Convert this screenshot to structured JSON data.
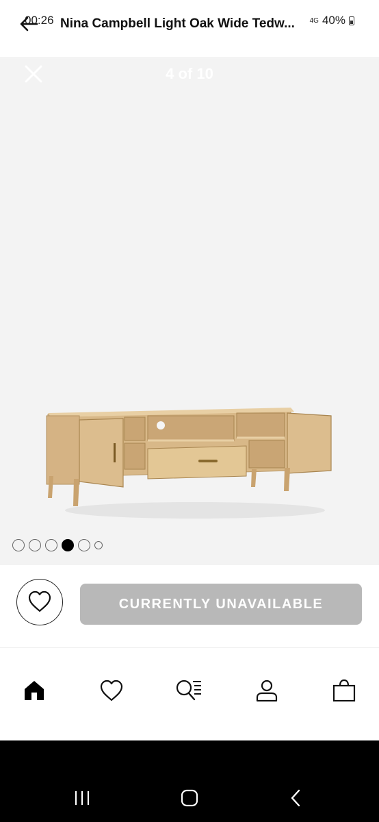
{
  "status_bar": {
    "time": "00:26",
    "network": "4G",
    "battery": "40%"
  },
  "header": {
    "title": "Nina Campbell Light Oak Wide Tedw..."
  },
  "gallery": {
    "counter": "4 of 10",
    "current_index": 4,
    "dot_count": 6,
    "image_icon": "tv-stand-image"
  },
  "actions": {
    "wishlist_icon": "heart-icon",
    "unavailable_label": "CURRENTLY UNAVAILABLE"
  },
  "bottom_nav": {
    "items": [
      "home-icon",
      "wishlist-icon",
      "search-icon",
      "account-icon",
      "basket-icon"
    ],
    "active": "home-icon"
  },
  "system_nav": {
    "items": [
      "recent-apps-icon",
      "home-button-icon",
      "back-icon"
    ]
  },
  "colors": {
    "gallery_bg": "#f3f3f3",
    "disabled_button": "#b8b8b8",
    "system_bar": "#000000",
    "wood": "#d9b98a"
  }
}
